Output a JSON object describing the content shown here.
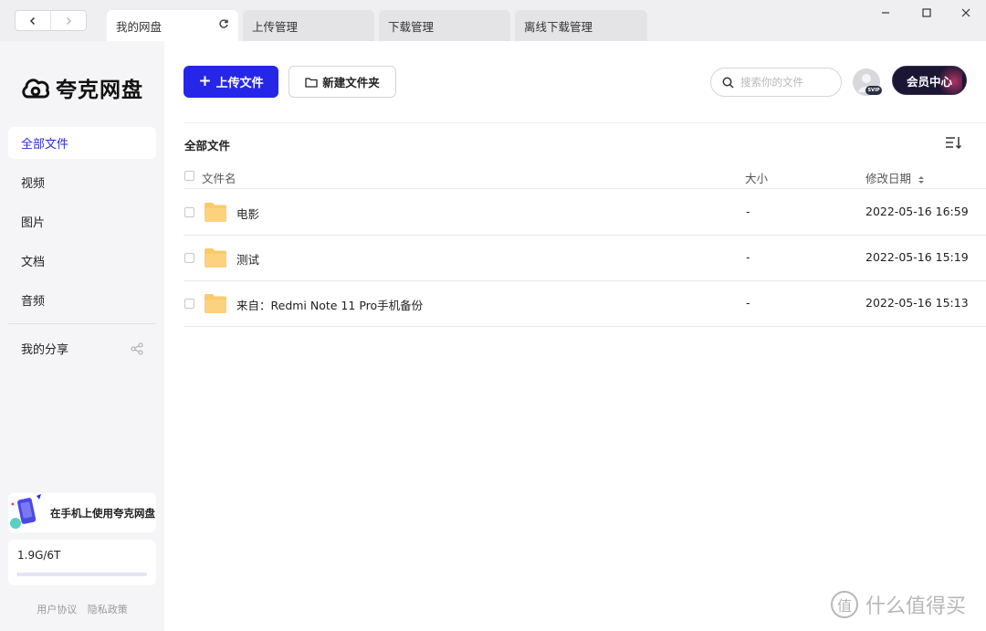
{
  "tabs": [
    {
      "label": "我的网盘"
    },
    {
      "label": "上传管理"
    },
    {
      "label": "下载管理"
    },
    {
      "label": "离线下载管理"
    }
  ],
  "nav": {
    "back_icon": "chevron-left-icon",
    "forward_icon": "chevron-right-icon"
  },
  "window": {
    "minimize_icon": "minimize-icon",
    "maximize_icon": "maximize-icon",
    "close_icon": "close-icon"
  },
  "sidebar": {
    "brand": "夸克网盘",
    "items": [
      {
        "label": "全部文件",
        "active": true
      },
      {
        "label": "视频"
      },
      {
        "label": "图片"
      },
      {
        "label": "文档"
      },
      {
        "label": "音频"
      },
      {
        "label": "我的分享"
      }
    ],
    "promo": "在手机上使用夸克网盘",
    "storage": {
      "text": "1.9G/6T",
      "used_fraction": 0.0003
    },
    "footer": {
      "agreement": "用户协议",
      "privacy": "隐私政策"
    }
  },
  "toolbar": {
    "upload_label": "上传文件",
    "new_folder_label": "新建文件夹",
    "search_placeholder": "搜索你的文件",
    "avatar_badge": "SVIP",
    "member_label": "会员中心"
  },
  "breadcrumb": "全部文件",
  "table": {
    "columns": {
      "name": "文件名",
      "size": "大小",
      "date": "修改日期"
    },
    "rows": [
      {
        "name": "电影",
        "size": "-",
        "date": "2022-05-16 16:59"
      },
      {
        "name": "测试",
        "size": "-",
        "date": "2022-05-16 15:19"
      },
      {
        "name": "来自：Redmi Note 11 Pro手机备份",
        "size": "-",
        "date": "2022-05-16 15:13"
      }
    ]
  },
  "watermark": {
    "symbol": "值",
    "text": "什么值得买"
  },
  "colors": {
    "accent": "#2626e9",
    "folder": "#fcc96b",
    "sidebar_bg": "#f5f5f7"
  }
}
